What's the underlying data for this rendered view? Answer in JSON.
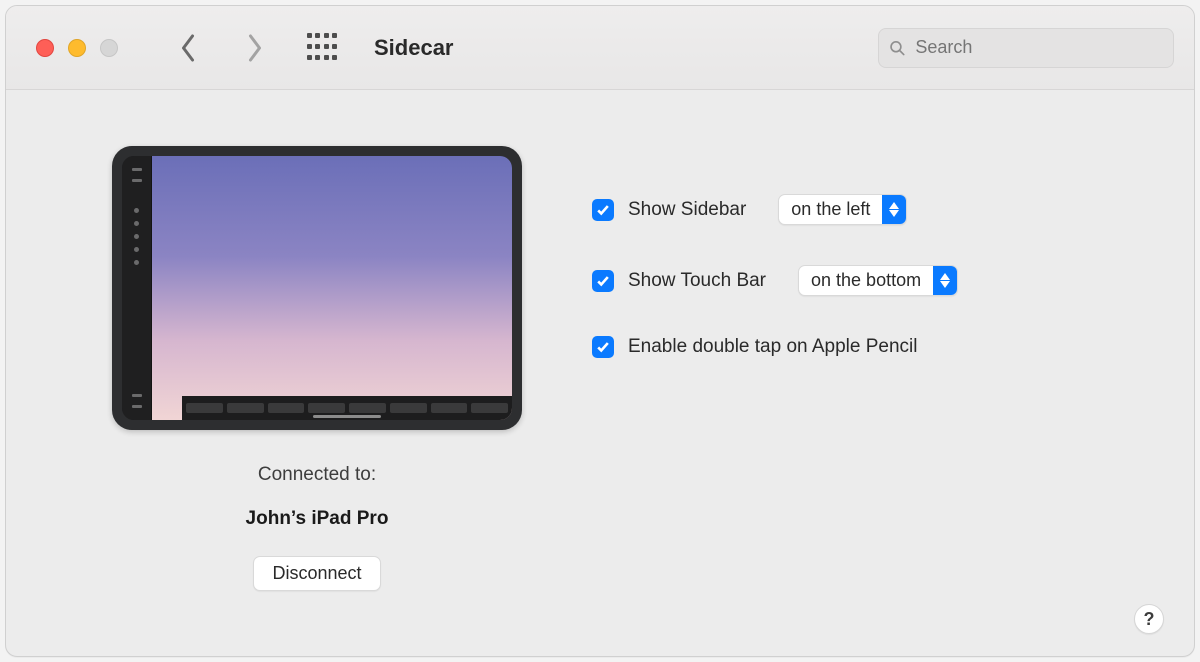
{
  "window": {
    "title": "Sidecar",
    "search_placeholder": "Search"
  },
  "device": {
    "connected_label": "Connected to:",
    "name": "John’s iPad Pro",
    "disconnect_label": "Disconnect"
  },
  "options": {
    "show_sidebar": {
      "label": "Show Sidebar",
      "checked": true,
      "position": "on the left"
    },
    "show_touchbar": {
      "label": "Show Touch Bar",
      "checked": true,
      "position": "on the bottom"
    },
    "double_tap": {
      "label": "Enable double tap on Apple Pencil",
      "checked": true
    }
  },
  "help_label": "?"
}
